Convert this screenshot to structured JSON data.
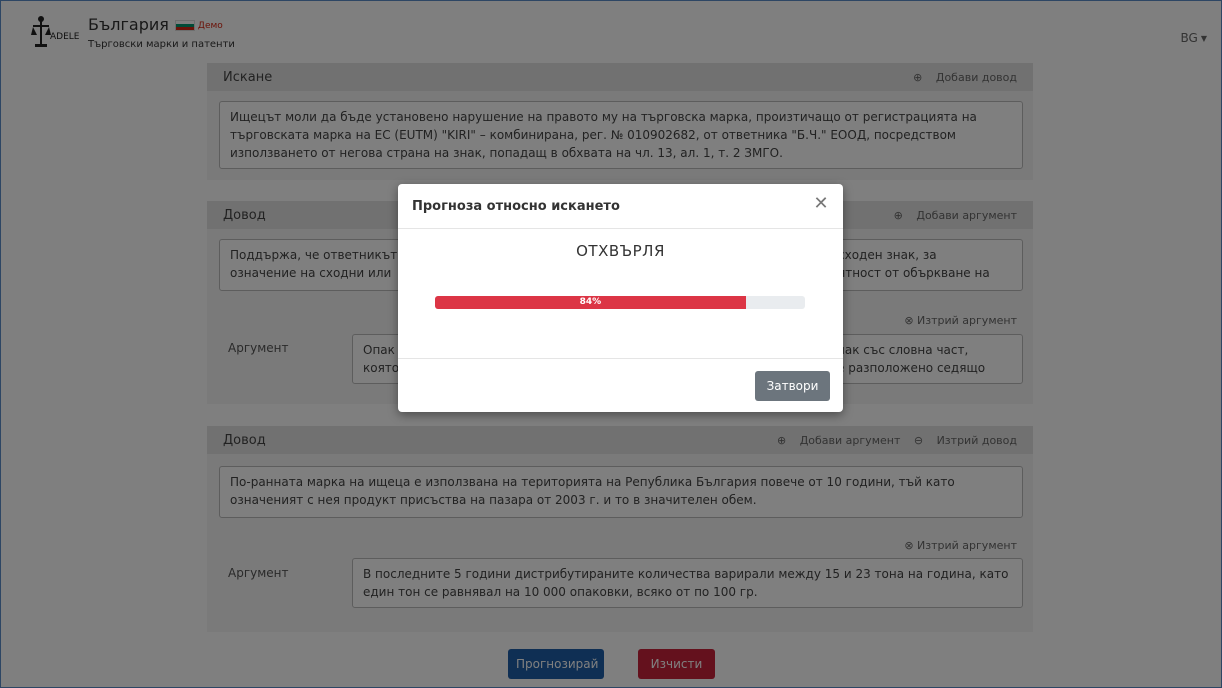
{
  "header": {
    "country": "България",
    "demo_label": "Демо",
    "subtitle": "Търговски марки и патенти",
    "logo_text": "ADELE",
    "language": "BG"
  },
  "claim": {
    "title": "Искане",
    "add_reason": "Добави довод",
    "text": "Ищецът моли да бъде установено нарушение на правото му на търговска марка, произтичащо от регистрацията на търговската марка на ЕС (EUTM) \"KIRI\" – комбинирана, рег. № 010902682, от ответника \"Б.Ч.\" ЕООД, посредством използването от негова страна на знак, попадащ в обхвата на чл. 13, ал. 1, т. 2 ЗМГО."
  },
  "reason1": {
    "title": "Довод",
    "add_argument": "Добави аргумент",
    "text_left": "Поддържа, че ответникът",
    "text_left2": "означение на сходни или",
    "text_right": "сходен знак, за",
    "text_right2": "ятност от объркване на",
    "delete_argument": "Изтрий аргумент",
    "argument_label": "Аргумент",
    "arg_left": "Опак",
    "arg_left2": "която",
    "arg_right": "нак със словна част,",
    "arg_right2": "е разположено седящо"
  },
  "reason2": {
    "title": "Довод",
    "add_argument": "Добави аргумент",
    "delete_reason": "Изтрий довод",
    "text": "По-ранната марка на ищеца е използвана на територията на Република България повече от 10 години, тъй като означеният с нея продукт присъства на пазара от 2003 г. и то в значителен обем.",
    "delete_argument": "Изтрий аргумент",
    "argument_label": "Аргумент",
    "argument_text": "В последните 5 години дистрибутираните количества варирали между 15 и 23 тона на година, като един тон се равнявал на 10 000 опаковки, всяко от по 100 гр."
  },
  "buttons": {
    "predict": "Прогнозирай",
    "clear": "Изчисти"
  },
  "modal": {
    "title": "Прогноза относно искането",
    "verdict": "ОТХВЪРЛЯ",
    "progress_percent": 84,
    "progress_label": "84%",
    "close_button": "Затвори"
  },
  "colors": {
    "primary": "#1f5fa8",
    "danger": "#c9233a",
    "progress": "#dc3545",
    "secondary": "#6c757d"
  }
}
